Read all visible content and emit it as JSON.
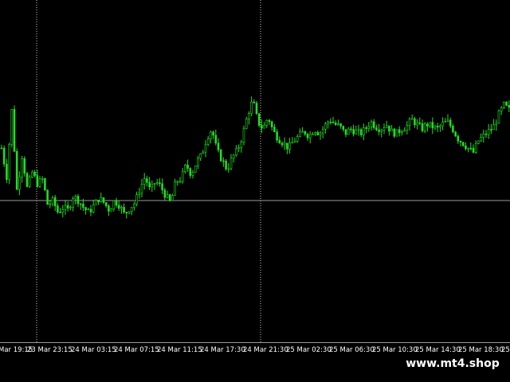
{
  "colors": {
    "background": "#000000",
    "candle": "#22dd22",
    "grid": "#c8c8c8",
    "price_line": "#9a9a9a",
    "axis_text": "#ffffff"
  },
  "time_axis": {
    "labels": [
      "Mar 19:15",
      "23 Mar 23:15",
      "24 Mar 03:15",
      "24 Mar 07:15",
      "24 Mar 11:15",
      "24 Mar 17:30",
      "24 Mar 21:30",
      "25 Mar 02:30",
      "25 Mar 06:30",
      "25 Mar 10:30",
      "25 Mar 14:30",
      "25 Mar 18:30",
      "25"
    ]
  },
  "watermark": {
    "text": "www.mt4.shop"
  },
  "chart_data": {
    "type": "line",
    "series": [
      {
        "values": [
          0.58,
          0.46,
          0.74,
          0.4,
          0.55,
          0.41,
          0.48,
          0.43,
          0.45,
          0.34,
          0.36,
          0.31,
          0.33,
          0.32,
          0.38,
          0.36,
          0.33,
          0.31,
          0.34,
          0.37,
          0.35,
          0.32,
          0.36,
          0.34,
          0.3,
          0.33,
          0.35,
          0.41,
          0.46,
          0.4,
          0.44,
          0.42,
          0.38,
          0.35,
          0.44,
          0.45,
          0.51,
          0.47,
          0.52,
          0.55,
          0.62,
          0.66,
          0.57,
          0.53,
          0.49,
          0.54,
          0.57,
          0.63,
          0.72,
          0.78,
          0.69,
          0.66,
          0.71,
          0.65,
          0.62,
          0.6,
          0.58,
          0.61,
          0.63,
          0.65,
          0.63,
          0.66,
          0.64,
          0.67,
          0.7,
          0.68,
          0.67,
          0.64,
          0.66,
          0.65,
          0.64,
          0.66,
          0.69,
          0.67,
          0.66,
          0.68,
          0.65,
          0.64,
          0.66,
          0.67,
          0.7,
          0.68,
          0.66,
          0.68,
          0.67,
          0.66,
          0.68,
          0.69,
          0.66,
          0.62,
          0.6,
          0.58,
          0.56,
          0.61,
          0.63,
          0.65,
          0.67,
          0.72,
          0.76,
          0.74
        ]
      }
    ],
    "grid": true,
    "ylim": [
      0,
      1
    ]
  }
}
